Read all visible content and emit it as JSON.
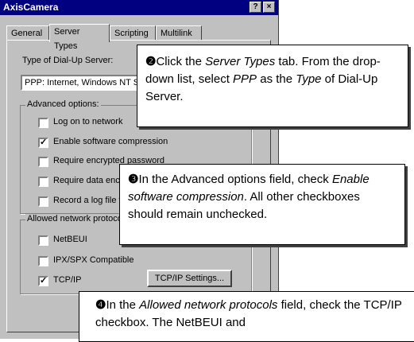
{
  "window": {
    "title": "AxisCamera",
    "help_button": "?",
    "close_button": "×"
  },
  "tabs": [
    "General",
    "Server Types",
    "Scripting",
    "Multilink"
  ],
  "server_type": {
    "label": "Type of Dial-Up Server:",
    "value": "PPP: Internet, Windows NT Server"
  },
  "advanced_options": {
    "title": "Advanced options:",
    "items": [
      {
        "label": "Log on to network",
        "checked": false
      },
      {
        "label": "Enable software compression",
        "checked": true
      },
      {
        "label": "Require encrypted password",
        "checked": false
      },
      {
        "label": "Require data encryption",
        "checked": false
      },
      {
        "label": "Record a log file for this connection",
        "checked": false
      }
    ]
  },
  "protocols": {
    "title": "Allowed network protocols:",
    "items": [
      {
        "label": "NetBEUI",
        "checked": false
      },
      {
        "label": "IPX/SPX Compatible",
        "checked": false
      },
      {
        "label": "TCP/IP",
        "checked": true
      }
    ],
    "tcpip_settings_button": "TCP/IP Settings..."
  },
  "callouts": {
    "step2": {
      "num": "❷",
      "t1": "Click the ",
      "e1": "Server Types",
      "t2": " tab. From the drop-down list, select ",
      "e2": "PPP",
      "t3": " as the ",
      "e3": "Type",
      "t4": " of Dial-Up Server."
    },
    "step3": {
      "num": "❸",
      "t1": "In the Advanced options field, check ",
      "e1": "Enable software compression",
      "t2": ". All other checkboxes should remain unchecked."
    },
    "step4": {
      "num": "❹",
      "t1": "In the ",
      "e1": "Allowed network protocols",
      "t2": " field, check the TCP/IP checkbox. The NetBEUI and"
    }
  }
}
